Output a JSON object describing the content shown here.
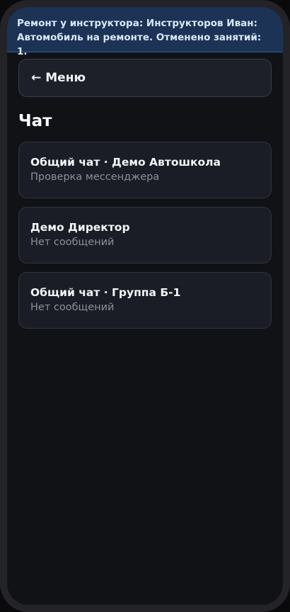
{
  "banner": {
    "text": "Ремонт у инструктора: Инструкторов Иван: Автомобиль на ремонте. Отменено занятий: 1."
  },
  "nav": {
    "back_arrow": "←",
    "back_label": "Меню"
  },
  "page": {
    "title": "Чат"
  },
  "chats": [
    {
      "title": "Общий чат · Демо Автошкола",
      "subtitle": "Проверка мессенджера"
    },
    {
      "title": "Демо Директор",
      "subtitle": "Нет сообщений"
    },
    {
      "title": "Общий чат · Группа Б-1",
      "subtitle": "Нет сообщений"
    }
  ]
}
